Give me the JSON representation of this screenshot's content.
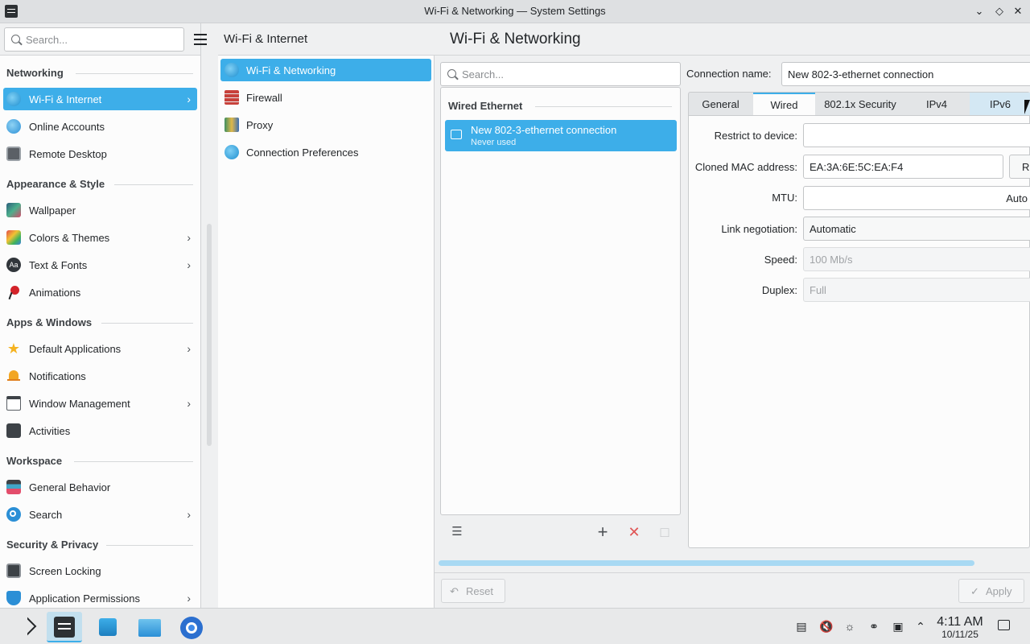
{
  "window": {
    "title": "Wi-Fi & Networking — System Settings"
  },
  "sidebar": {
    "search_placeholder": "Search...",
    "sections": {
      "networking": "Networking",
      "appearance": "Appearance & Style",
      "apps": "Apps & Windows",
      "workspace": "Workspace",
      "security": "Security & Privacy"
    },
    "items": {
      "wifi": "Wi-Fi & Internet",
      "online": "Online Accounts",
      "remote": "Remote Desktop",
      "wallpaper": "Wallpaper",
      "colors": "Colors & Themes",
      "text": "Text & Fonts",
      "animations": "Animations",
      "default_apps": "Default Applications",
      "notifications": "Notifications",
      "window_mgmt": "Window Management",
      "activities": "Activities",
      "general": "General Behavior",
      "search": "Search",
      "screen_locking": "Screen Locking",
      "app_permissions": "Application Permissions"
    }
  },
  "middle": {
    "title": "Wi-Fi & Internet",
    "items": {
      "wifi_networking": "Wi-Fi & Networking",
      "firewall": "Firewall",
      "proxy": "Proxy",
      "connection_prefs": "Connection Preferences"
    }
  },
  "right": {
    "title": "Wi-Fi & Networking",
    "search_placeholder": "Search...",
    "group_label": "Wired Ethernet",
    "connection": {
      "name": "New 802-3-ethernet connection",
      "status": "Never used"
    },
    "connection_name_label": "Connection name:",
    "connection_name_value": "New 802-3-ethernet connection",
    "tabs": {
      "general": "General",
      "wired": "Wired",
      "security": "802.1x Security",
      "ipv4": "IPv4",
      "ipv6": "IPv6"
    },
    "fields": {
      "restrict_label": "Restrict to device:",
      "restrict_value": "",
      "mac_label": "Cloned MAC address:",
      "mac_value": "EA:3A:6E:5C:EA:F4",
      "mac_button": "Ra",
      "mtu_label": "MTU:",
      "mtu_value": "Auto",
      "link_label": "Link negotiation:",
      "link_value": "Automatic",
      "speed_label": "Speed:",
      "speed_value": "100 Mb/s",
      "duplex_label": "Duplex:",
      "duplex_value": "Full"
    },
    "reset_label": "Reset",
    "apply_label": "Apply"
  },
  "taskbar": {
    "time": "4:11 AM",
    "date": "10/11/25"
  },
  "colors": {
    "accent": "#3daee9"
  }
}
